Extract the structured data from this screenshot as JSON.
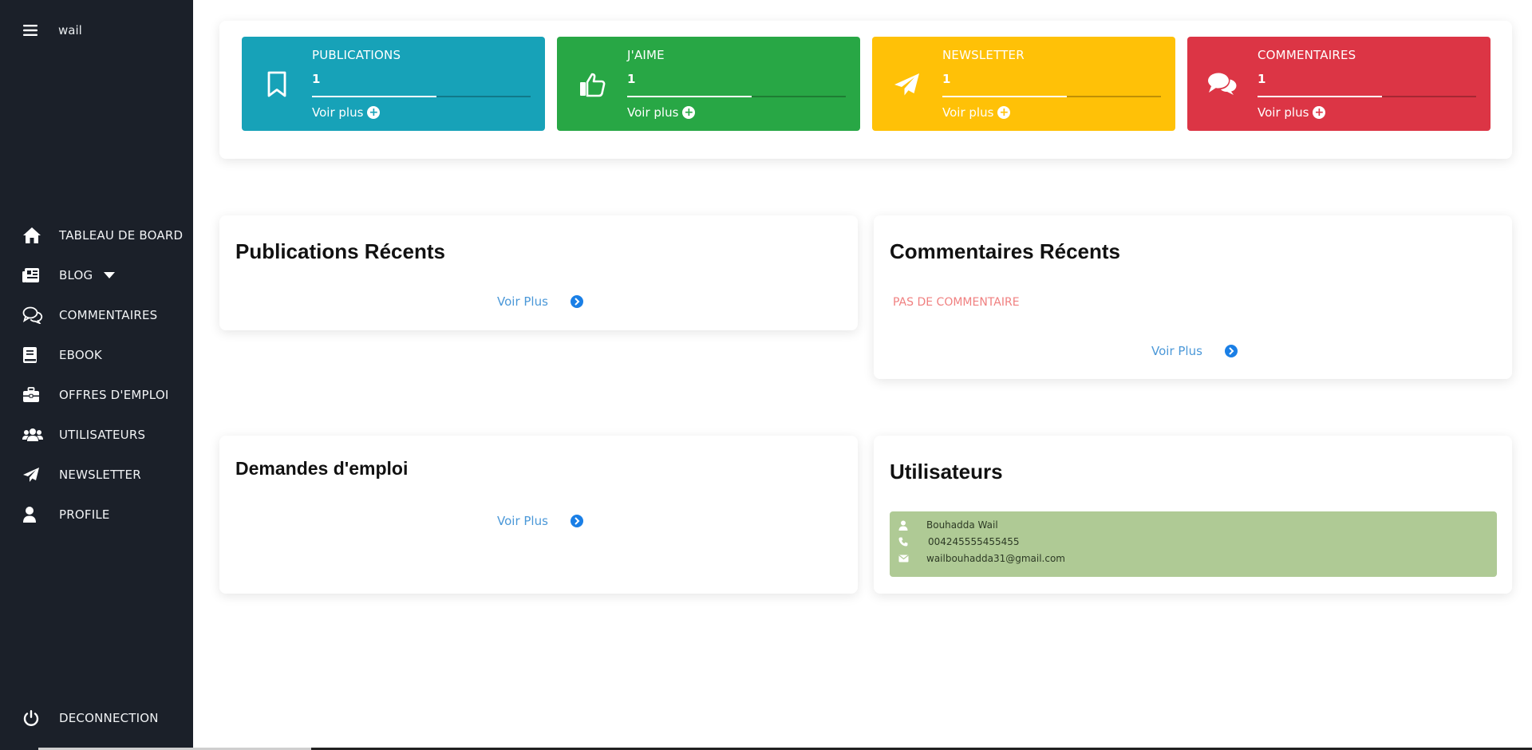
{
  "header": {
    "username": "wail"
  },
  "sidebar": {
    "items": [
      {
        "label": "TABLEAU DE BOARD",
        "icon": "home-icon"
      },
      {
        "label": "BLOG",
        "icon": "newspaper-icon"
      },
      {
        "label": "COMMENTAIRES",
        "icon": "comments-icon"
      },
      {
        "label": "EBOOK",
        "icon": "book-icon"
      },
      {
        "label": "OFFRES D'EMPLOI",
        "icon": "briefcase-icon"
      },
      {
        "label": "UTILISATEURS",
        "icon": "users-icon"
      },
      {
        "label": "NEWSLETTER",
        "icon": "paper-plane-icon"
      },
      {
        "label": "PROFILE",
        "icon": "user-icon"
      }
    ],
    "logout_label": "DECONNECTION"
  },
  "stats": [
    {
      "title": "PUBLICATIONS",
      "count": "1",
      "more": "Voir plus",
      "color": "#17a2b8",
      "progress": 0.57,
      "icon": "bookmark-icon"
    },
    {
      "title": "J'AIME",
      "count": "1",
      "more": "Voir plus",
      "color": "#28a745",
      "progress": 0.57,
      "icon": "thumbs-up-icon"
    },
    {
      "title": "NEWSLETTER",
      "count": "1",
      "more": "Voir plus",
      "color": "#ffc107",
      "progress": 0.57,
      "icon": "paper-plane-icon"
    },
    {
      "title": "COMMENTAIRES",
      "count": "1",
      "more": "Voir plus",
      "color": "#dc3545",
      "progress": 0.57,
      "icon": "comments-icon"
    }
  ],
  "panels": {
    "publications": {
      "title": "Publications Récents",
      "more": "Voir Plus"
    },
    "commentaires": {
      "title": "Commentaires Récents",
      "empty": "PAS DE COMMENTAIRE",
      "more": "Voir Plus"
    },
    "demandes": {
      "title": "Demandes d'emploi",
      "more": "Voir Plus"
    },
    "utilisateurs": {
      "title": "Utilisateurs",
      "user": {
        "name": "Bouhadda Wail",
        "phone": "004245555455455",
        "email": "wailbouhadda31@gmail.com"
      }
    }
  },
  "colors": {
    "sidebar": "#1b2029",
    "link": "#4b98d8",
    "accent": "#1a7fe6",
    "empty_text": "#f08080",
    "user_box": "#afca95"
  }
}
